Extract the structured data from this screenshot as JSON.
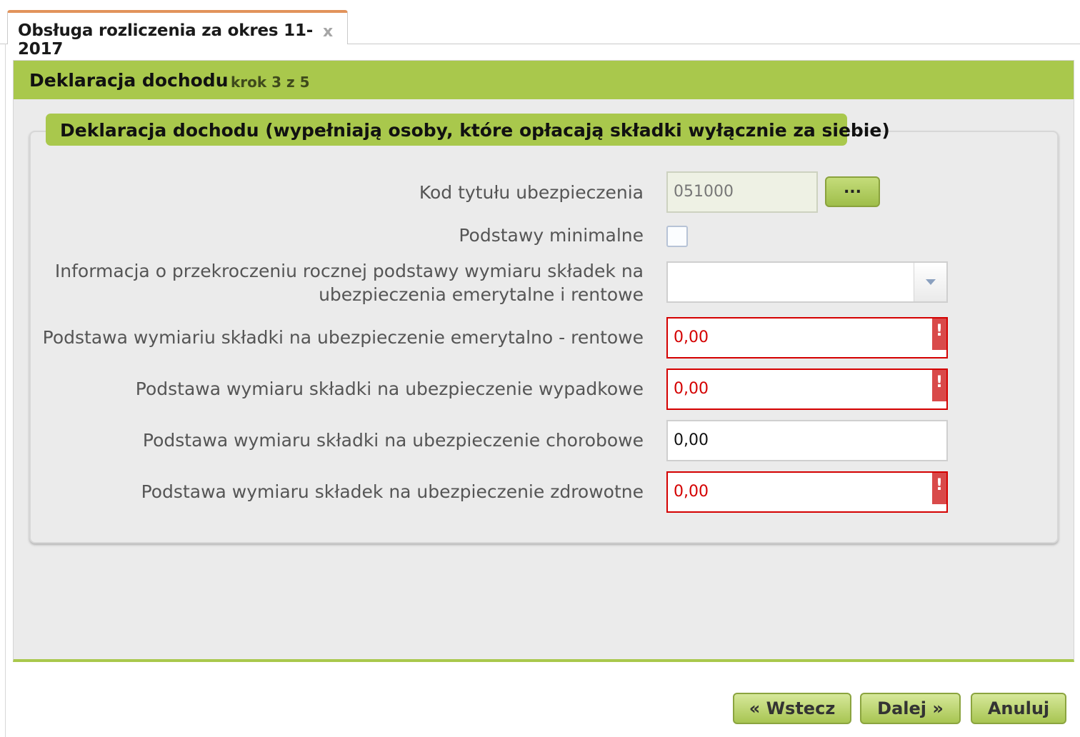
{
  "tab": {
    "title": "Obsługa rozliczenia za okres 11-2017",
    "close_glyph": "x"
  },
  "wizard": {
    "title": "Deklaracja dochodu",
    "step": "krok 3 z 5"
  },
  "section": {
    "legend": "Deklaracja dochodu (wypełniają osoby, które opłacają składki wyłącznie za siebie)"
  },
  "fields": {
    "kod_tytulu": {
      "label": "Kod tytułu ubezpieczenia",
      "value": "051000",
      "picker_label": "..."
    },
    "podstawy_minimalne": {
      "label": "Podstawy minimalne",
      "checked": false
    },
    "informacja": {
      "label_line1": "Informacja o przekroczeniu rocznej podstawy wymiaru składek na",
      "label_line2": "ubezpieczenia emerytalne i rentowe",
      "value": ""
    },
    "emerytalno_rentowe": {
      "label": "Podstawa wymiariu składki na ubezpieczenie emerytalno - rentowe",
      "value": "0,00",
      "error": true
    },
    "wypadkowe": {
      "label": "Podstawa wymiaru składki na ubezpieczenie wypadkowe",
      "value": "0,00",
      "error": true
    },
    "chorobowe": {
      "label": "Podstawa wymiaru składki na ubezpieczenie chorobowe",
      "value": "0,00",
      "error": false
    },
    "zdrowotne": {
      "label": "Podstawa wymiaru składek na ubezpieczenie zdrowotne",
      "value": "0,00",
      "error": true
    }
  },
  "error_flag": "!",
  "buttons": {
    "back": "« Wstecz",
    "next": "Dalej »",
    "cancel": "Anuluj"
  },
  "colors": {
    "header_green": "#a9c84c",
    "tab_accent": "#e2935b",
    "error_red": "#d40000"
  },
  "icons": {
    "close": "close-icon",
    "dropdown": "chevron-down-icon",
    "error": "error-flag-icon"
  }
}
